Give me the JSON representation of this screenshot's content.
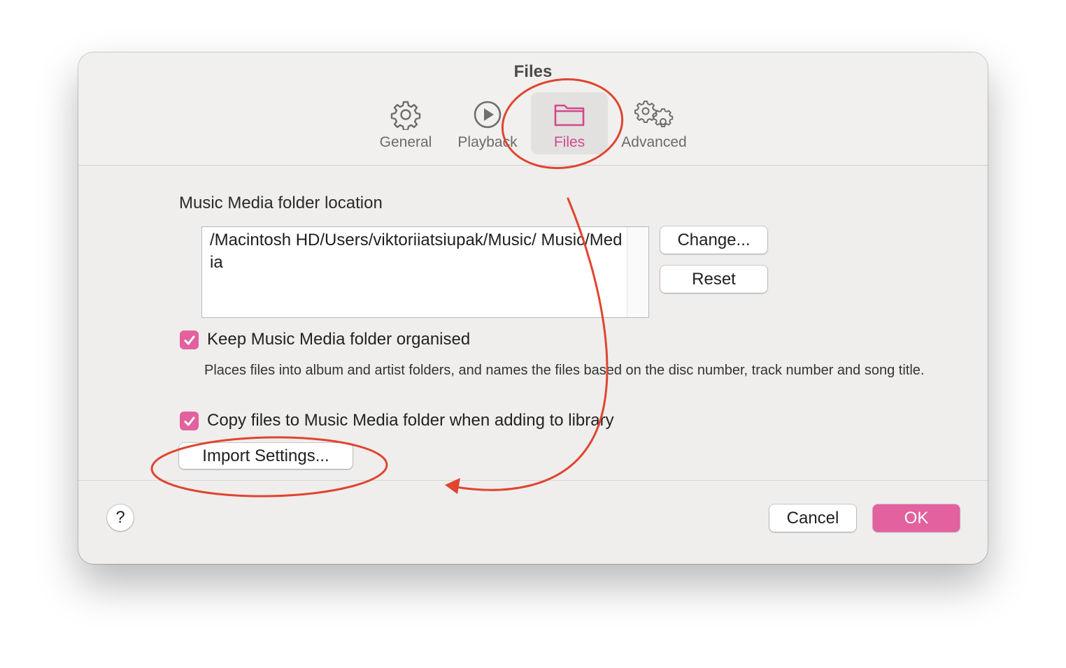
{
  "window": {
    "title": "Files"
  },
  "tabs": [
    {
      "label": "General",
      "icon": "gear-icon"
    },
    {
      "label": "Playback",
      "icon": "play-circle-icon"
    },
    {
      "label": "Files",
      "icon": "folder-icon",
      "active": true
    },
    {
      "label": "Advanced",
      "icon": "gears-icon"
    }
  ],
  "files": {
    "location_label": "Music Media folder location",
    "path": "/Macintosh HD/Users/viktoriiatsiupak/Music/ Music/Media",
    "change_label": "Change...",
    "reset_label": "Reset",
    "keep_organised": {
      "label": "Keep Music Media folder organised",
      "checked": true,
      "description": "Places files into album and artist folders, and names the files based on the disc number, track number and song title."
    },
    "copy_files": {
      "label": "Copy files to Music Media folder when adding to library",
      "checked": true
    },
    "import_settings_label": "Import Settings..."
  },
  "footer": {
    "help_label": "?",
    "cancel_label": "Cancel",
    "ok_label": "OK"
  },
  "colors": {
    "accent": "#e2619e",
    "active_tab_text": "#d2498b",
    "annotation": "#e0452f"
  }
}
